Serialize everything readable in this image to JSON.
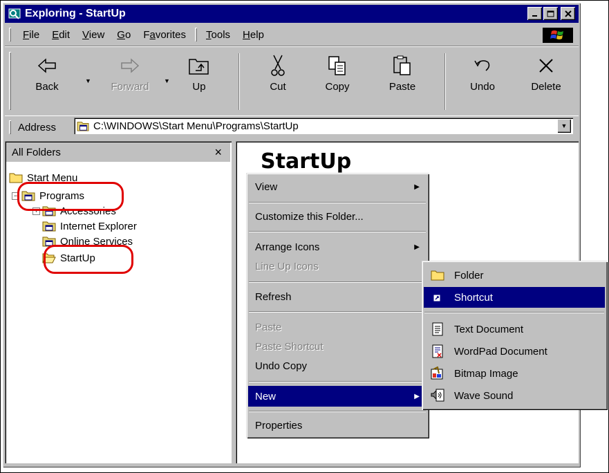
{
  "window": {
    "title": "Exploring - StartUp"
  },
  "menubar": {
    "items": [
      {
        "pre": "",
        "key": "F",
        "post": "ile"
      },
      {
        "pre": "",
        "key": "E",
        "post": "dit"
      },
      {
        "pre": "",
        "key": "V",
        "post": "iew"
      },
      {
        "pre": "",
        "key": "G",
        "post": "o"
      },
      {
        "pre": "F",
        "key": "a",
        "post": "vorites"
      },
      {
        "pre": "",
        "key": "T",
        "post": "ools"
      },
      {
        "pre": "",
        "key": "H",
        "post": "elp"
      }
    ]
  },
  "toolbar": {
    "back": "Back",
    "forward": "Forward",
    "up": "Up",
    "cut": "Cut",
    "copy": "Copy",
    "paste": "Paste",
    "undo": "Undo",
    "delete": "Delete"
  },
  "address": {
    "label": "Address",
    "value": "C:\\WINDOWS\\Start Menu\\Programs\\StartUp"
  },
  "left_pane": {
    "header": "All Folders",
    "close": "×",
    "tree": {
      "start_menu": "Start Menu",
      "programs": "Programs",
      "accessories": "Accessories",
      "internet_explorer": "Internet Explorer",
      "online_services": "Online Services",
      "startup": "StartUp"
    }
  },
  "right_pane": {
    "title": "StartUp"
  },
  "context_menu": {
    "view": "View",
    "customize": "Customize this Folder...",
    "arrange_icons": "Arrange Icons",
    "line_up_icons": "Line Up Icons",
    "refresh": "Refresh",
    "paste": "Paste",
    "paste_shortcut": "Paste Shortcut",
    "undo_copy": "Undo Copy",
    "new": "New",
    "properties": "Properties"
  },
  "submenu": {
    "folder": "Folder",
    "shortcut": "Shortcut",
    "text_document": "Text Document",
    "wordpad_document": "WordPad Document",
    "bitmap_image": "Bitmap Image",
    "wave_sound": "Wave Sound"
  },
  "colors": {
    "titlebar": "#000080",
    "selection": "#000080",
    "face": "#c0c0c0",
    "highlight_oval": "#e00000"
  }
}
